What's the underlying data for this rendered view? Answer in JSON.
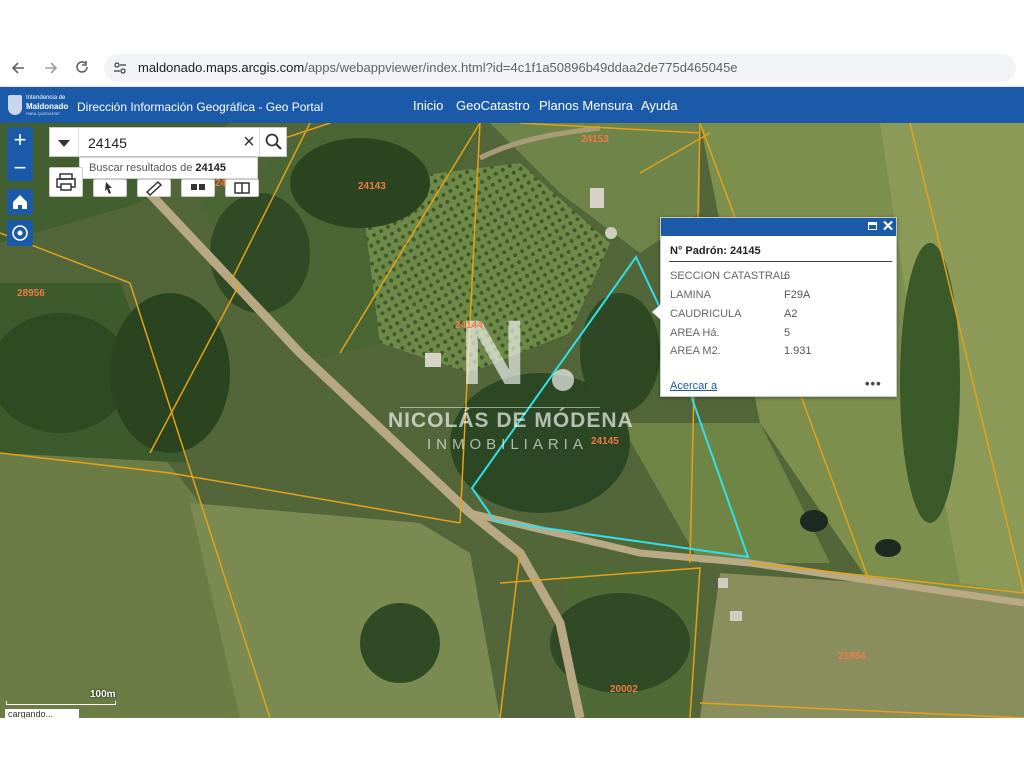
{
  "browser": {
    "url_host": "maldonado.maps.arcgis.com",
    "url_path": "/apps/webappviewer/index.html?id=4c1f1a50896b49ddaa2de775d465045e"
  },
  "header": {
    "logo_line1": "Intendencia de",
    "logo_line2": "Maldonado",
    "logo_line3": "PARA QUEDARSE",
    "title": "Dirección Información Geográfica -  Geo Portal",
    "nav": [
      "Inicio",
      "GeoCatastro",
      "Planos Mensura",
      "Ayuda"
    ]
  },
  "search": {
    "value": "24145",
    "suggestion_prefix": "Buscar resultados de ",
    "suggestion_term": "24145"
  },
  "watermark": {
    "letter": "N",
    "name": "NICOLÁS DE MÓDENA",
    "sub": "INMOBILIARIA"
  },
  "parcels": [
    "24153",
    "24143",
    "28956",
    "24144",
    "24145",
    "21884",
    "20002",
    "24"
  ],
  "popup": {
    "title": "N° Padrón: 24145",
    "rows": [
      {
        "k": "SECCION CATASTRAL",
        "v": "6"
      },
      {
        "k": "LAMINA",
        "v": "F29A"
      },
      {
        "k": "CAUDRICULA",
        "v": "A2"
      },
      {
        "k": "AREA Há.",
        "v": "5"
      },
      {
        "k": "AREA M2.",
        "v": "1.931"
      }
    ],
    "zoom_link": "Acercar a",
    "more": "•••"
  },
  "scale": "100m",
  "status": "cargando...",
  "colors": {
    "header": "#1b5aa8",
    "parcel_line": "#e3a21a",
    "highlight": "#2fe0e6",
    "parcel_label": "#f07a4a"
  }
}
